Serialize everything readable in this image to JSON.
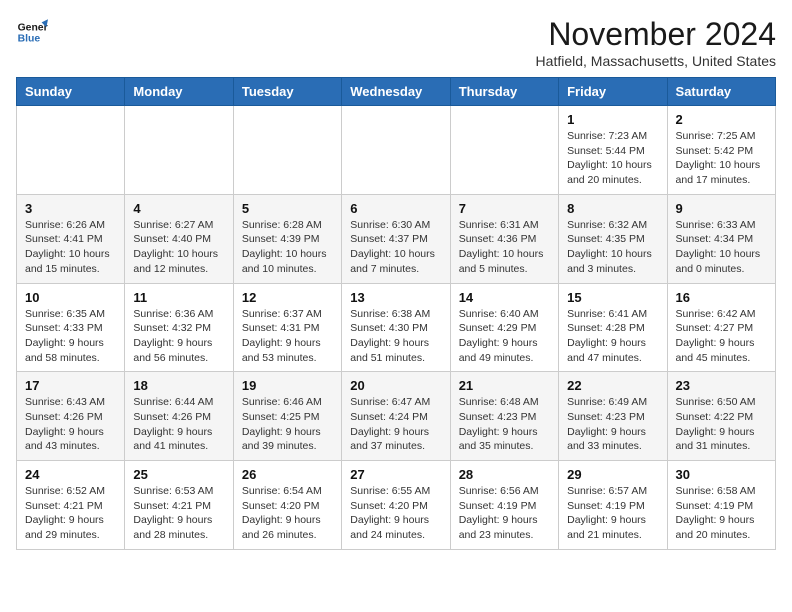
{
  "logo": {
    "line1": "General",
    "line2": "Blue"
  },
  "title": "November 2024",
  "location": "Hatfield, Massachusetts, United States",
  "days_of_week": [
    "Sunday",
    "Monday",
    "Tuesday",
    "Wednesday",
    "Thursday",
    "Friday",
    "Saturday"
  ],
  "weeks": [
    [
      {
        "day": "",
        "info": ""
      },
      {
        "day": "",
        "info": ""
      },
      {
        "day": "",
        "info": ""
      },
      {
        "day": "",
        "info": ""
      },
      {
        "day": "",
        "info": ""
      },
      {
        "day": "1",
        "info": "Sunrise: 7:23 AM\nSunset: 5:44 PM\nDaylight: 10 hours\nand 20 minutes."
      },
      {
        "day": "2",
        "info": "Sunrise: 7:25 AM\nSunset: 5:42 PM\nDaylight: 10 hours\nand 17 minutes."
      }
    ],
    [
      {
        "day": "3",
        "info": "Sunrise: 6:26 AM\nSunset: 4:41 PM\nDaylight: 10 hours\nand 15 minutes."
      },
      {
        "day": "4",
        "info": "Sunrise: 6:27 AM\nSunset: 4:40 PM\nDaylight: 10 hours\nand 12 minutes."
      },
      {
        "day": "5",
        "info": "Sunrise: 6:28 AM\nSunset: 4:39 PM\nDaylight: 10 hours\nand 10 minutes."
      },
      {
        "day": "6",
        "info": "Sunrise: 6:30 AM\nSunset: 4:37 PM\nDaylight: 10 hours\nand 7 minutes."
      },
      {
        "day": "7",
        "info": "Sunrise: 6:31 AM\nSunset: 4:36 PM\nDaylight: 10 hours\nand 5 minutes."
      },
      {
        "day": "8",
        "info": "Sunrise: 6:32 AM\nSunset: 4:35 PM\nDaylight: 10 hours\nand 3 minutes."
      },
      {
        "day": "9",
        "info": "Sunrise: 6:33 AM\nSunset: 4:34 PM\nDaylight: 10 hours\nand 0 minutes."
      }
    ],
    [
      {
        "day": "10",
        "info": "Sunrise: 6:35 AM\nSunset: 4:33 PM\nDaylight: 9 hours\nand 58 minutes."
      },
      {
        "day": "11",
        "info": "Sunrise: 6:36 AM\nSunset: 4:32 PM\nDaylight: 9 hours\nand 56 minutes."
      },
      {
        "day": "12",
        "info": "Sunrise: 6:37 AM\nSunset: 4:31 PM\nDaylight: 9 hours\nand 53 minutes."
      },
      {
        "day": "13",
        "info": "Sunrise: 6:38 AM\nSunset: 4:30 PM\nDaylight: 9 hours\nand 51 minutes."
      },
      {
        "day": "14",
        "info": "Sunrise: 6:40 AM\nSunset: 4:29 PM\nDaylight: 9 hours\nand 49 minutes."
      },
      {
        "day": "15",
        "info": "Sunrise: 6:41 AM\nSunset: 4:28 PM\nDaylight: 9 hours\nand 47 minutes."
      },
      {
        "day": "16",
        "info": "Sunrise: 6:42 AM\nSunset: 4:27 PM\nDaylight: 9 hours\nand 45 minutes."
      }
    ],
    [
      {
        "day": "17",
        "info": "Sunrise: 6:43 AM\nSunset: 4:26 PM\nDaylight: 9 hours\nand 43 minutes."
      },
      {
        "day": "18",
        "info": "Sunrise: 6:44 AM\nSunset: 4:26 PM\nDaylight: 9 hours\nand 41 minutes."
      },
      {
        "day": "19",
        "info": "Sunrise: 6:46 AM\nSunset: 4:25 PM\nDaylight: 9 hours\nand 39 minutes."
      },
      {
        "day": "20",
        "info": "Sunrise: 6:47 AM\nSunset: 4:24 PM\nDaylight: 9 hours\nand 37 minutes."
      },
      {
        "day": "21",
        "info": "Sunrise: 6:48 AM\nSunset: 4:23 PM\nDaylight: 9 hours\nand 35 minutes."
      },
      {
        "day": "22",
        "info": "Sunrise: 6:49 AM\nSunset: 4:23 PM\nDaylight: 9 hours\nand 33 minutes."
      },
      {
        "day": "23",
        "info": "Sunrise: 6:50 AM\nSunset: 4:22 PM\nDaylight: 9 hours\nand 31 minutes."
      }
    ],
    [
      {
        "day": "24",
        "info": "Sunrise: 6:52 AM\nSunset: 4:21 PM\nDaylight: 9 hours\nand 29 minutes."
      },
      {
        "day": "25",
        "info": "Sunrise: 6:53 AM\nSunset: 4:21 PM\nDaylight: 9 hours\nand 28 minutes."
      },
      {
        "day": "26",
        "info": "Sunrise: 6:54 AM\nSunset: 4:20 PM\nDaylight: 9 hours\nand 26 minutes."
      },
      {
        "day": "27",
        "info": "Sunrise: 6:55 AM\nSunset: 4:20 PM\nDaylight: 9 hours\nand 24 minutes."
      },
      {
        "day": "28",
        "info": "Sunrise: 6:56 AM\nSunset: 4:19 PM\nDaylight: 9 hours\nand 23 minutes."
      },
      {
        "day": "29",
        "info": "Sunrise: 6:57 AM\nSunset: 4:19 PM\nDaylight: 9 hours\nand 21 minutes."
      },
      {
        "day": "30",
        "info": "Sunrise: 6:58 AM\nSunset: 4:19 PM\nDaylight: 9 hours\nand 20 minutes."
      }
    ]
  ]
}
